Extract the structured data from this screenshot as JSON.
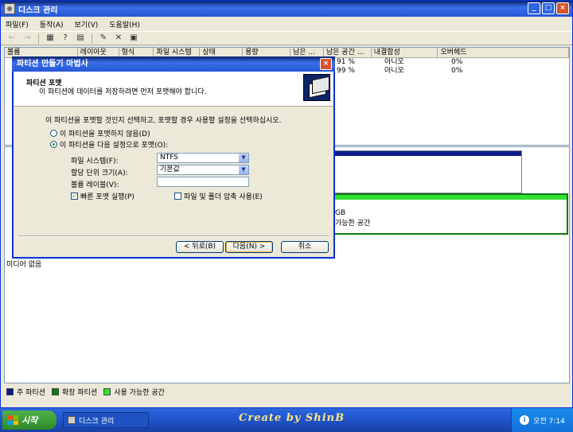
{
  "window": {
    "title": "디스크 관리",
    "minimize": "_",
    "maximize": "□",
    "close": "×"
  },
  "menu": [
    "파일(F)",
    "동작(A)",
    "보기(V)",
    "도움말(H)"
  ],
  "toolbar": [
    "←",
    "→",
    "▦",
    "?",
    "▤",
    "✎",
    "✕",
    "▣"
  ],
  "volume_table": {
    "columns": [
      "볼륨",
      "레이아웃",
      "형식",
      "파일 시스템",
      "상태",
      "용량",
      "남은 ...",
      "남은 공간 ...",
      "내결함성",
      "오버헤드"
    ],
    "rows": [
      [
        "91 %",
        "아니오",
        "0%"
      ],
      [
        "99 %",
        "아니오",
        "0%"
      ]
    ]
  },
  "disk_map": {
    "label_no_media": "미디어 없음",
    "free_size_fragment": "GB",
    "free_label_fragment": "가능한 공간"
  },
  "legend": [
    {
      "label": "주 파티션",
      "color": "#0a1a8a"
    },
    {
      "label": "확장 파티션",
      "color": "#0a7a14"
    },
    {
      "label": "사용 가능한 공간",
      "color": "#33e033"
    }
  ],
  "dialog": {
    "title": "파티션 만들기 마법사",
    "close": "×",
    "header_title": "파티션 포맷",
    "header_sub": "이 파티션에 데이터를 저장하려면 먼저 포맷해야 합니다.",
    "instruction": "이 파티션을 포맷할 것인지 선택하고, 포맷할 경우 사용할 설정을 선택하십시오.",
    "radio_no_format": "이 파티션을 포맷하지 않음(D)",
    "radio_format": "이 파티션을 다음 설정으로 포맷(O):",
    "fs_label": "파일 시스템(F):",
    "fs_value": "NTFS",
    "alloc_label": "할당 단위 크기(A):",
    "alloc_value": "기본값",
    "vol_label_label": "볼륨 레이블(V):",
    "vol_label_value": "",
    "quick_format": "빠른 포맷 실행(P)",
    "compression": "파일 및 폴더 압축 사용(E)",
    "back_button": "< 뒤로(B)",
    "next_button": "다음(N) >",
    "cancel_button": "취소"
  },
  "taskbar": {
    "start": "시작",
    "task": "디스크 관리",
    "watermark": "Create by ShinB",
    "clock": "오전 7:14"
  }
}
